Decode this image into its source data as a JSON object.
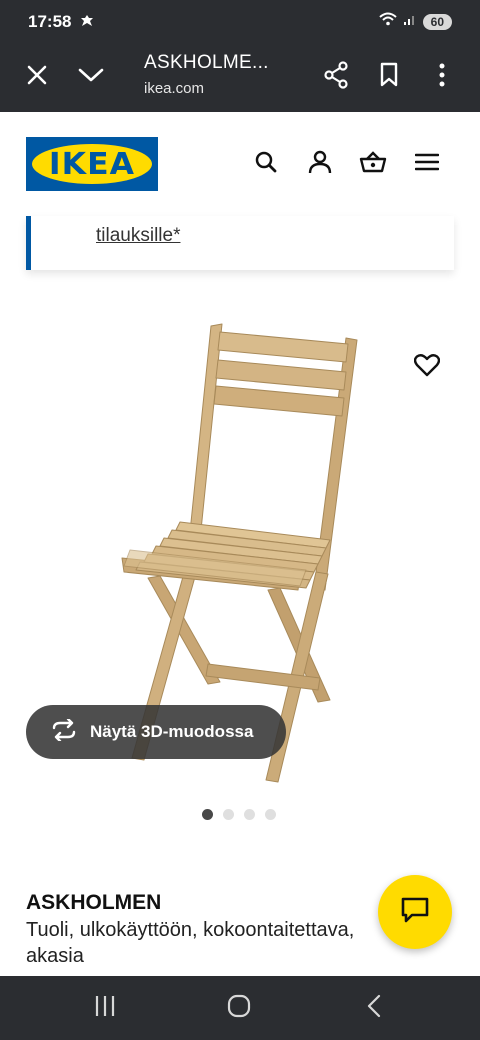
{
  "status_bar": {
    "time": "17:58",
    "battery": "60"
  },
  "browser": {
    "title": "ASKHOLME...",
    "url": "ikea.com"
  },
  "header": {
    "logo_text": "IKEA"
  },
  "notice": {
    "link_text": "tilauksille*"
  },
  "product": {
    "view_3d_label": "Näytä 3D-muodossa",
    "carousel": {
      "total": 4,
      "active_index": 0
    },
    "name": "ASKHOLMEN",
    "description": "Tuoli, ulkokäyttöön, kokoontaitettava, akasia"
  },
  "colors": {
    "ikea_blue": "#0058a3",
    "ikea_yellow": "#ffdb00",
    "chrome_dark": "#2b2d31",
    "wood": "#cfae7c"
  },
  "icons": [
    "close-icon",
    "chevron-down-icon",
    "share-icon",
    "bookmark-icon",
    "more-vert-icon",
    "search-icon",
    "user-icon",
    "basket-icon",
    "menu-icon",
    "heart-icon",
    "rotate-3d-icon",
    "chat-icon",
    "recent-apps-icon",
    "home-icon",
    "back-icon"
  ]
}
